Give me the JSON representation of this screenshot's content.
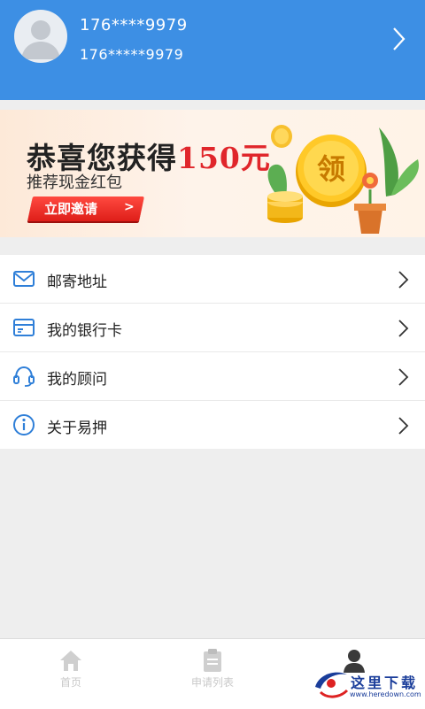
{
  "header": {
    "phone_primary": "176****9979",
    "phone_secondary": "176*****9979"
  },
  "banner": {
    "title_prefix": "恭喜您获得",
    "title_amount": "150元",
    "subtitle": "推荐现金红包",
    "button_label": "立即邀请",
    "button_arrow": ">",
    "coin_char": "领"
  },
  "menu": {
    "items": [
      {
        "label": "邮寄地址",
        "icon": "mail-icon"
      },
      {
        "label": "我的银行卡",
        "icon": "bank-card-icon"
      },
      {
        "label": "我的顾问",
        "icon": "headset-icon"
      },
      {
        "label": "关于易押",
        "icon": "info-icon"
      }
    ]
  },
  "nav": {
    "items": [
      {
        "label": "首页",
        "icon": "home-icon"
      },
      {
        "label": "申请列表",
        "icon": "clipboard-icon"
      },
      {
        "label": "",
        "icon": "person-icon",
        "active": true
      }
    ]
  },
  "watermark": {
    "text": "这里下载",
    "url": "www.heredown.com"
  },
  "colors": {
    "header_bg": "#3d8fe4",
    "accent_red": "#e0262b",
    "page_bg": "#eeeeee"
  }
}
